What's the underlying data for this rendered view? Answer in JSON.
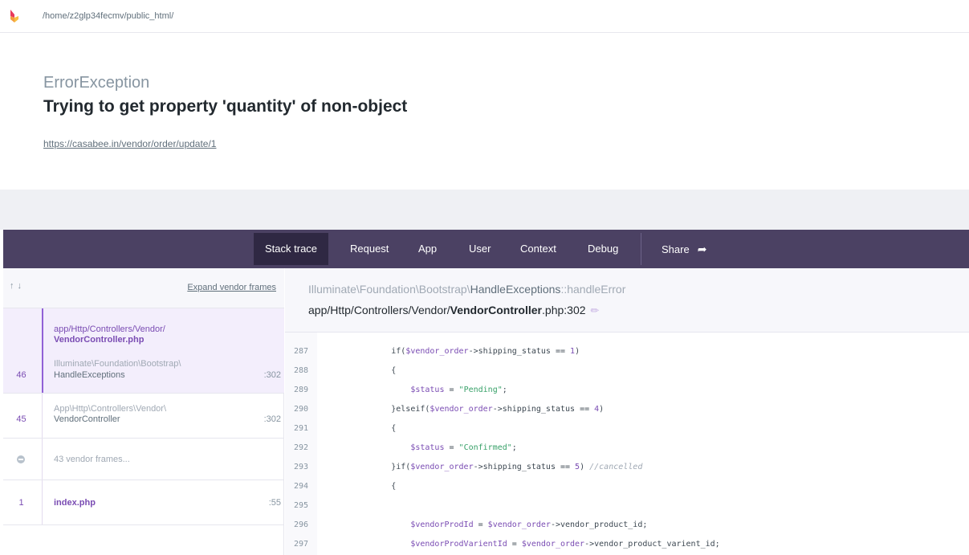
{
  "topbar": {
    "logo_icon": "ignition-flame-icon",
    "path": "/home/z2glp34fecmv/public_html/"
  },
  "exception": {
    "class": "ErrorException",
    "message": "Trying to get property 'quantity' of non-object",
    "url": "https://casabee.in/vendor/order/update/1"
  },
  "nav": {
    "tabs": [
      {
        "label": "Stack trace",
        "active": true
      },
      {
        "label": "Request",
        "active": false
      },
      {
        "label": "App",
        "active": false
      },
      {
        "label": "User",
        "active": false
      },
      {
        "label": "Context",
        "active": false
      },
      {
        "label": "Debug",
        "active": false
      }
    ],
    "share_label": "Share"
  },
  "sidebar": {
    "arrows": "↑↓",
    "expand_label": "Expand vendor frames",
    "frames": [
      {
        "number": "46",
        "file_dir": "app/Http/Controllers/Vendor/",
        "file_name": "VendorController.php",
        "class_ns": "Illuminate\\Foundation\\Bootstrap\\",
        "class_name": "HandleExceptions",
        "line": ":302"
      },
      {
        "number": "45",
        "class_ns": "App\\Http\\Controllers\\Vendor\\",
        "class_name": "VendorController",
        "line": ":302"
      },
      {
        "vendor_label": "43 vendor frames..."
      },
      {
        "number": "1",
        "file_name": "index.php",
        "line": ":55"
      }
    ]
  },
  "content": {
    "class_ns": "Illuminate\\Foundation\\Bootstrap\\",
    "class_name": "HandleExceptions",
    "method": "::handleError",
    "file_dir": "app/Http/Controllers/Vendor/",
    "file_name": "VendorController",
    "file_ext": ".php:302",
    "edit_icon": "pencil-icon"
  },
  "code": {
    "lines": [
      {
        "n": "287",
        "t": "            if($vendor_order->shipping_status == 1)"
      },
      {
        "n": "288",
        "t": "            {"
      },
      {
        "n": "289",
        "t": "                $status = \"Pending\";"
      },
      {
        "n": "290",
        "t": "            }elseif($vendor_order->shipping_status == 4)"
      },
      {
        "n": "291",
        "t": "            {"
      },
      {
        "n": "292",
        "t": "                $status = \"Confirmed\";"
      },
      {
        "n": "293",
        "t": "            }if($vendor_order->shipping_status == 5) //cancelled"
      },
      {
        "n": "294",
        "t": "            {"
      },
      {
        "n": "295",
        "t": ""
      },
      {
        "n": "296",
        "t": "                $vendorProdId = $vendor_order->vendor_product_id;"
      },
      {
        "n": "297",
        "t": "                $vendorProdVarientId = $vendor_order->vendor_product_varient_id;"
      }
    ]
  }
}
